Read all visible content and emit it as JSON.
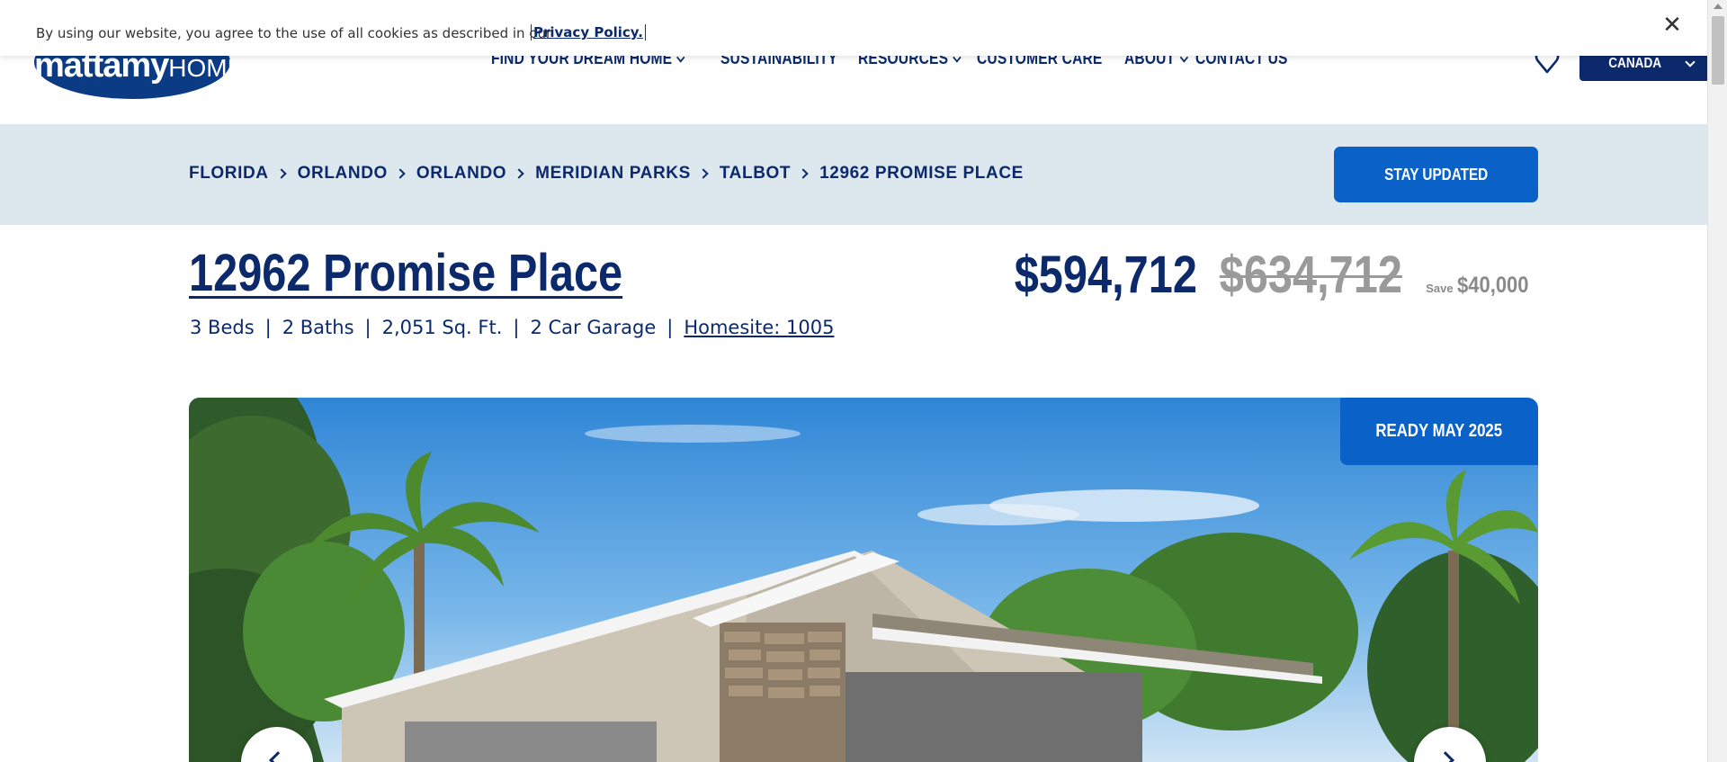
{
  "cookie_banner": {
    "text": "By using our website, you agree to the use of all cookies as described in our",
    "link_label": "Privacy Policy.",
    "close_glyph": "✕"
  },
  "header": {
    "logo": {
      "name": "mattamy",
      "suffix": "HOMES"
    },
    "nav": [
      {
        "label": "FIND YOUR DREAM HOME",
        "has_dropdown": true
      },
      {
        "label": "SUSTAINABILITY",
        "has_dropdown": false
      },
      {
        "label": "RESOURCES",
        "has_dropdown": true
      },
      {
        "label": "CUSTOMER CARE",
        "has_dropdown": false
      },
      {
        "label": "ABOUT",
        "has_dropdown": true
      },
      {
        "label": "CONTACT US",
        "has_dropdown": false
      }
    ],
    "favorites_icon": "heart-location-icon",
    "region_label": "CANADA"
  },
  "breadcrumb": {
    "items": [
      "FLORIDA",
      "ORLANDO",
      "ORLANDO",
      "MERIDIAN PARKS",
      "TALBOT",
      "12962 PROMISE PLACE"
    ],
    "cta_label": "STAY UPDATED"
  },
  "listing": {
    "title": "12962 Promise Place",
    "price": "$594,712",
    "original_price": "$634,712",
    "save_label": "Save",
    "save_amount": "$40,000",
    "specs": {
      "beds": "3 Beds",
      "baths": "2 Baths",
      "sqft": "2,051 Sq. Ft.",
      "garage": "2 Car Garage",
      "homesite": "Homesite: 1005",
      "separator": "|"
    }
  },
  "gallery": {
    "badge": "READY MAY 2025",
    "prev_icon": "chevron-left-icon",
    "next_icon": "chevron-right-icon"
  },
  "colors": {
    "brand_navy": "#0c2a6b",
    "brand_blue": "#0a62c9",
    "band_bg": "#dde7ee",
    "muted": "#9a9a9a"
  }
}
